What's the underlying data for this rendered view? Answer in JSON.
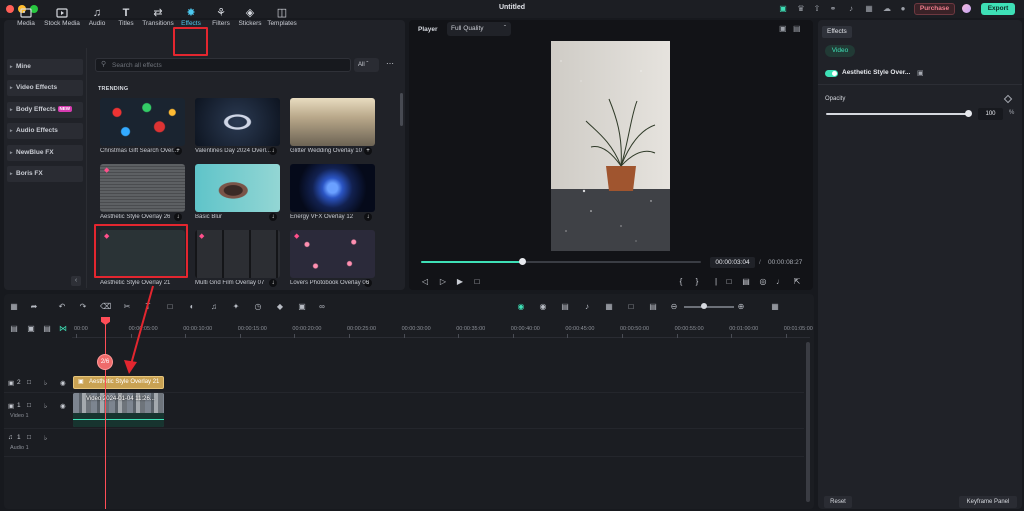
{
  "window": {
    "title": "Untitled"
  },
  "header": {
    "purchase_label": "Purchase",
    "export_label": "Export",
    "icons": [
      "gift-icon",
      "crown-icon",
      "upload-icon",
      "headset-icon",
      "bell-icon",
      "grid-icon",
      "download-cloud-icon"
    ]
  },
  "media_toolbar": {
    "items": [
      {
        "label": "Media",
        "icon": "media-icon"
      },
      {
        "label": "Stock Media",
        "icon": "stock-media-icon"
      },
      {
        "label": "Audio",
        "icon": "music-note-icon"
      },
      {
        "label": "Titles",
        "icon": "title-t-icon"
      },
      {
        "label": "Transitions",
        "icon": "transition-icon"
      },
      {
        "label": "Effects",
        "icon": "sparkle-icon",
        "active": true
      },
      {
        "label": "Filters",
        "icon": "filters-icon"
      },
      {
        "label": "Stickers",
        "icon": "sticker-icon"
      },
      {
        "label": "Templates",
        "icon": "templates-icon"
      }
    ]
  },
  "sidebar": {
    "items": [
      {
        "label": "Mine"
      },
      {
        "label": "Video Effects"
      },
      {
        "label": "Body Effects",
        "badge": "NEW"
      },
      {
        "label": "Audio Effects"
      },
      {
        "label": "NewBlue FX"
      },
      {
        "label": "Boris FX"
      }
    ]
  },
  "browser": {
    "search_placeholder": "Search all effects",
    "filter_value": "All",
    "section_title": "TRENDING",
    "cards": [
      {
        "label": "Christmas Gift Search Over..."
      },
      {
        "label": "Valentines Day 2024 Overl..."
      },
      {
        "label": "Glitter Wedding Overlay 10"
      },
      {
        "label": "Aesthetic Style Overlay 26"
      },
      {
        "label": "Basic Blur"
      },
      {
        "label": "Energy VFX Overlay 12"
      },
      {
        "label": "Aesthetic Style Overlay 21"
      },
      {
        "label": "Multi Grid Film Overlay 07"
      },
      {
        "label": "Lovers Photobook Overlay 06"
      }
    ]
  },
  "player": {
    "label": "Player",
    "quality": "Full Quality",
    "current_time": "00:00:03:04",
    "separator": "/",
    "total_time": "00:00:08:27",
    "progress": 0.36
  },
  "properties": {
    "tab_label": "Effects",
    "chip_label": "Video",
    "effect_name": "Aesthetic Style Over...",
    "opacity_label": "Opacity",
    "opacity_value": "100",
    "opacity_unit": "%",
    "opacity_level": 1.0,
    "reset_label": "Reset",
    "keyframe_label": "Keyframe Panel"
  },
  "timeline": {
    "ruler_labels": [
      "00:00",
      "00:00:05:00",
      "00:00:10:00",
      "00:00:15:00",
      "00:00:20:00",
      "00:00:25:00",
      "00:00:30:00",
      "00:00:35:00",
      "00:00:40:00",
      "00:00:45:00",
      "00:00:50:00",
      "00:00:55:00",
      "00:01:00:00",
      "00:01:05:00"
    ],
    "tracks": [
      {
        "index": "2",
        "name": ""
      },
      {
        "index": "1",
        "name": "Video 1"
      },
      {
        "index": "1",
        "name": "Audio 1"
      }
    ],
    "effect_clip_label": "Aesthetic Style Overlay 21",
    "video_clip_label": "Video 2024-01-04 11:26...",
    "drop_badge": "2/6"
  },
  "colors": {
    "accent": "#3ee0b6",
    "highlight_box": "#e3262f",
    "effect_clip": "#c9a253",
    "playhead": "#ff4d57"
  }
}
